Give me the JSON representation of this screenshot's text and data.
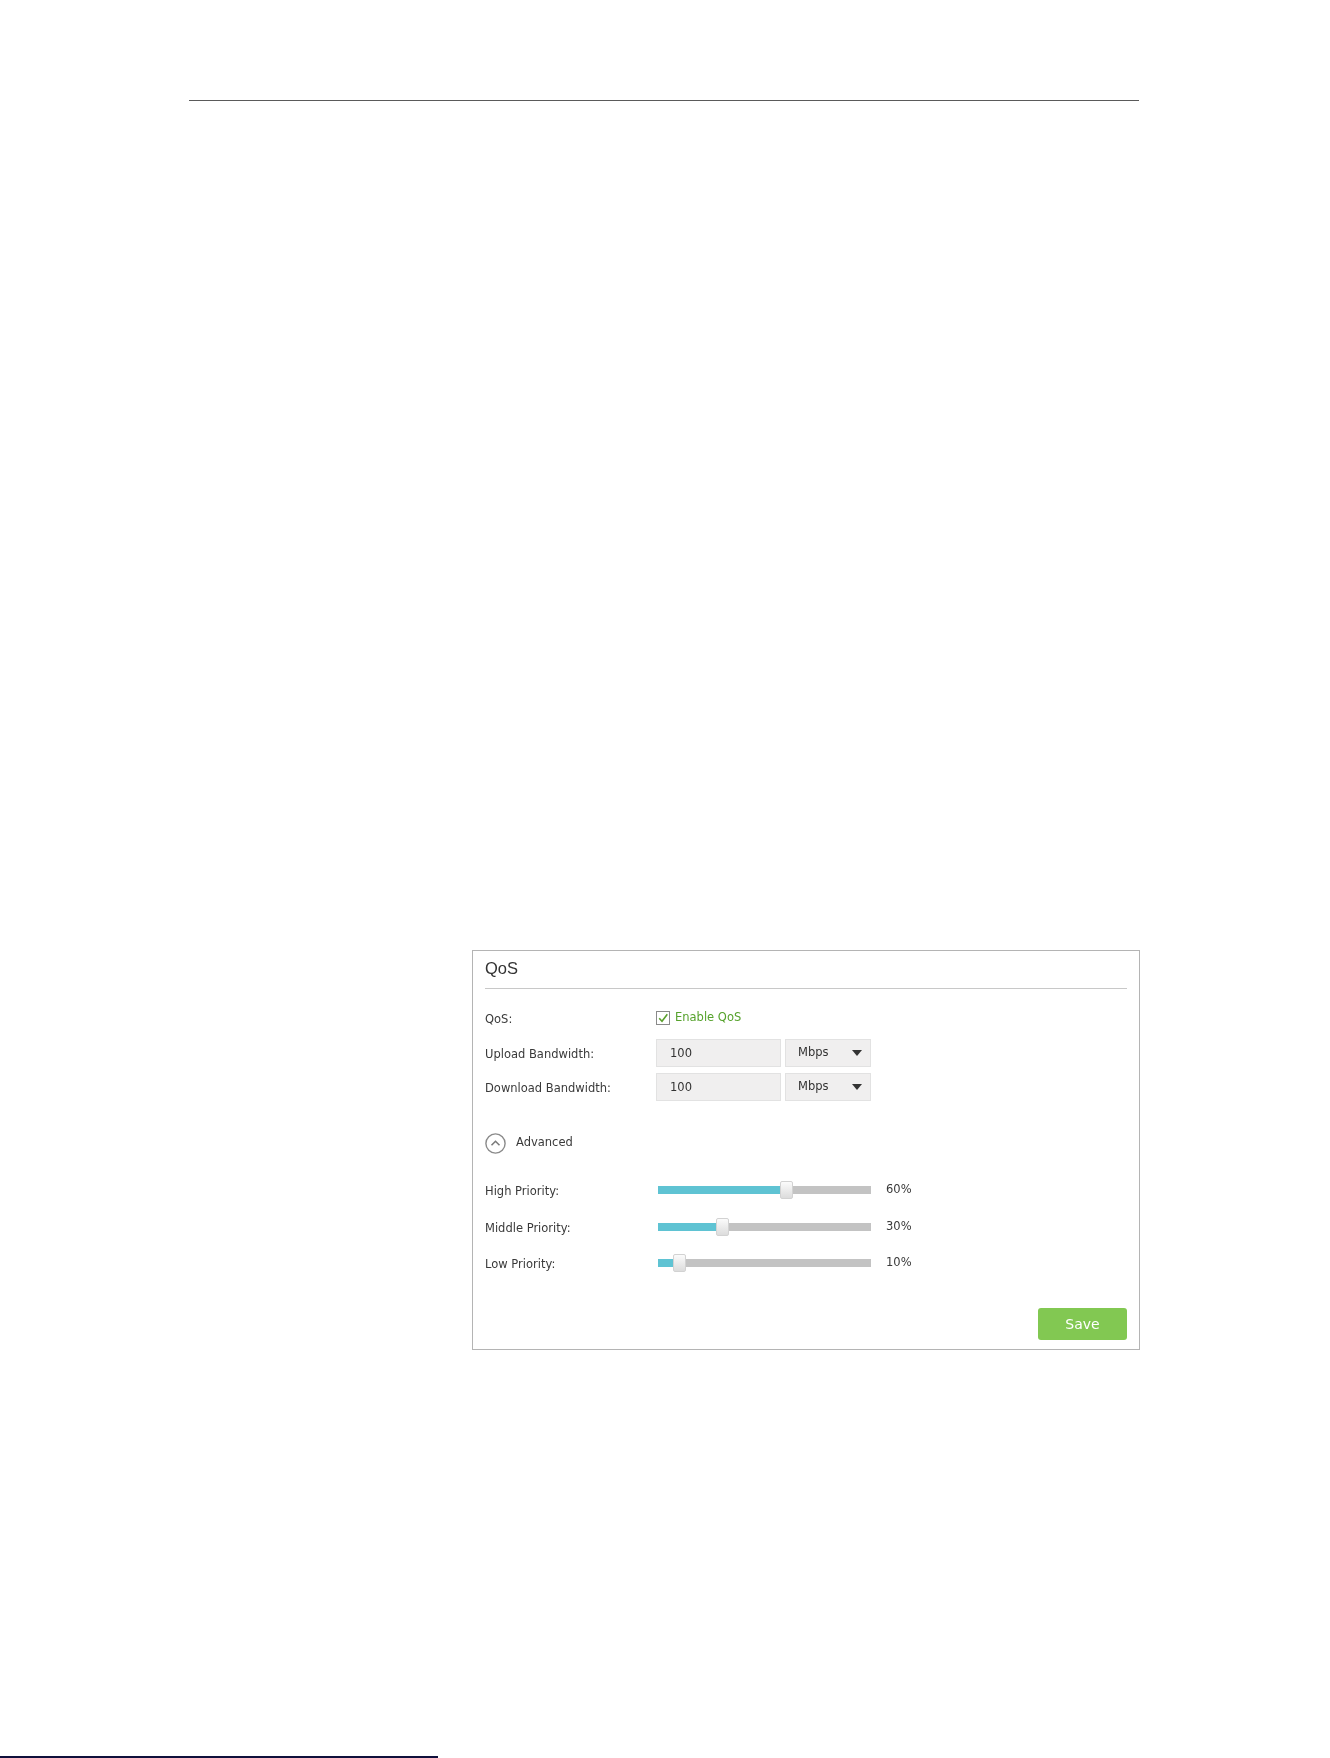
{
  "panel": {
    "title": "QoS"
  },
  "qos": {
    "label": "QoS:",
    "checkbox": {
      "label": "Enable QoS",
      "checked": true
    }
  },
  "bandwidth": [
    {
      "label": "Upload Bandwidth:",
      "value": "100",
      "unit": "Mbps"
    },
    {
      "label": "Download Bandwidth:",
      "value": "100",
      "unit": "Mbps"
    }
  ],
  "advanced": {
    "label": "Advanced",
    "expanded": true
  },
  "priorities": [
    {
      "label": "High Priority:",
      "level": 0.6,
      "reading": "60%"
    },
    {
      "label": "Middle Priority:",
      "level": 0.3,
      "reading": "30%"
    },
    {
      "label": "Low Priority:",
      "level": 0.1,
      "reading": "10%"
    }
  ],
  "buttons": [
    {
      "label": "Save"
    }
  ]
}
